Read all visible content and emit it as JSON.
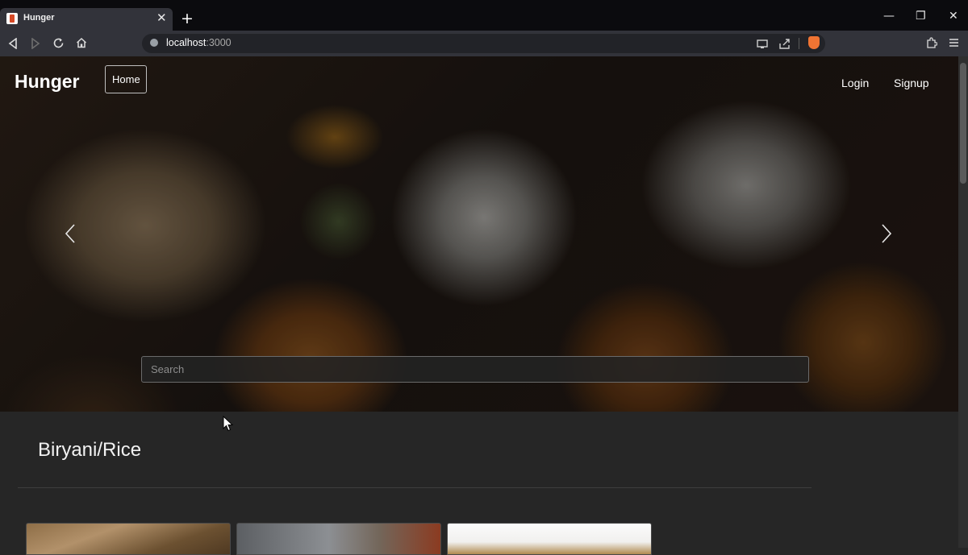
{
  "browser": {
    "tab_title": "Hunger",
    "tab_close": "✕",
    "new_tab": "+",
    "url_host": "localhost",
    "url_port": ":3000",
    "window_controls": {
      "minimize": "—",
      "restore": "❐",
      "close": "✕"
    },
    "nav_icons": [
      "back-icon",
      "forward-icon",
      "reload-icon",
      "home-icon"
    ]
  },
  "navbar": {
    "brand": "Hunger",
    "home": "Home",
    "login": "Login",
    "signup": "Signup"
  },
  "hero": {
    "search_placeholder": "Search",
    "prev_icon": "chevron-left-icon",
    "next_icon": "chevron-right-icon"
  },
  "content": {
    "section_title": "Biryani/Rice",
    "cards_visible": 3
  },
  "colors": {
    "page_bg": "#262626",
    "chrome_bg": "#32333a",
    "titlebar_bg": "#0b0b0e",
    "brave_accent": "#f07433"
  }
}
